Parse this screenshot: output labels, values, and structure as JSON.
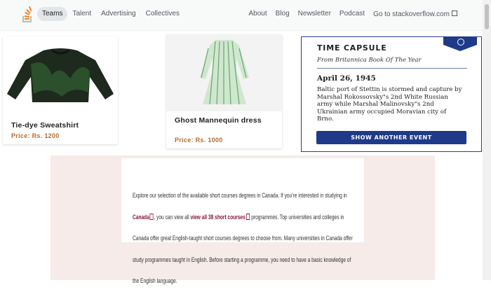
{
  "nav": {
    "left_items": [
      "Teams",
      "Talent",
      "Advertising",
      "Collectives"
    ],
    "right_items": [
      "About",
      "Blog",
      "Newsletter",
      "Podcast",
      "Go to stackoverflow.com"
    ]
  },
  "products": [
    {
      "title": "Tie-dye Sweatshirt",
      "price": "Price: Rs. 1200"
    },
    {
      "title": "Ghost Mannequin dress",
      "price": "Price: Rs. 1000"
    }
  ],
  "time_capsule": {
    "title": "TIME CAPSULE",
    "subtitle": "From Britannica Book Of The Year",
    "date": "April 26, 1945",
    "body": "Baltic port of Stettin is stormed and capture by Marshal Rokossovsky\"s 2nd White Russian army while Marshal Malinovsky\"s 2nd Ukrainian army occupied Moravian city of Brno.",
    "button": "SHOW ANOTHER EVENT"
  },
  "courses": {
    "text_1": "Explore our selection of the available short courses degrees in Canada. If you're interested in studying in ",
    "link_canada": "Canada",
    "text_2": ", you can view all ",
    "link_view_all": "view all 38 short courses",
    "text_3": " programmes. Top universities and colleges in Canada offer great English-taught short courses degrees to choose from. Many universities in Canada offer study programmes taught in English. Before starting a programme, you need to have a basic knowledge of the English language."
  },
  "colors": {
    "accent_blue": "#1f3a8a",
    "price": "#b36b2c",
    "link": "#8a1538"
  }
}
